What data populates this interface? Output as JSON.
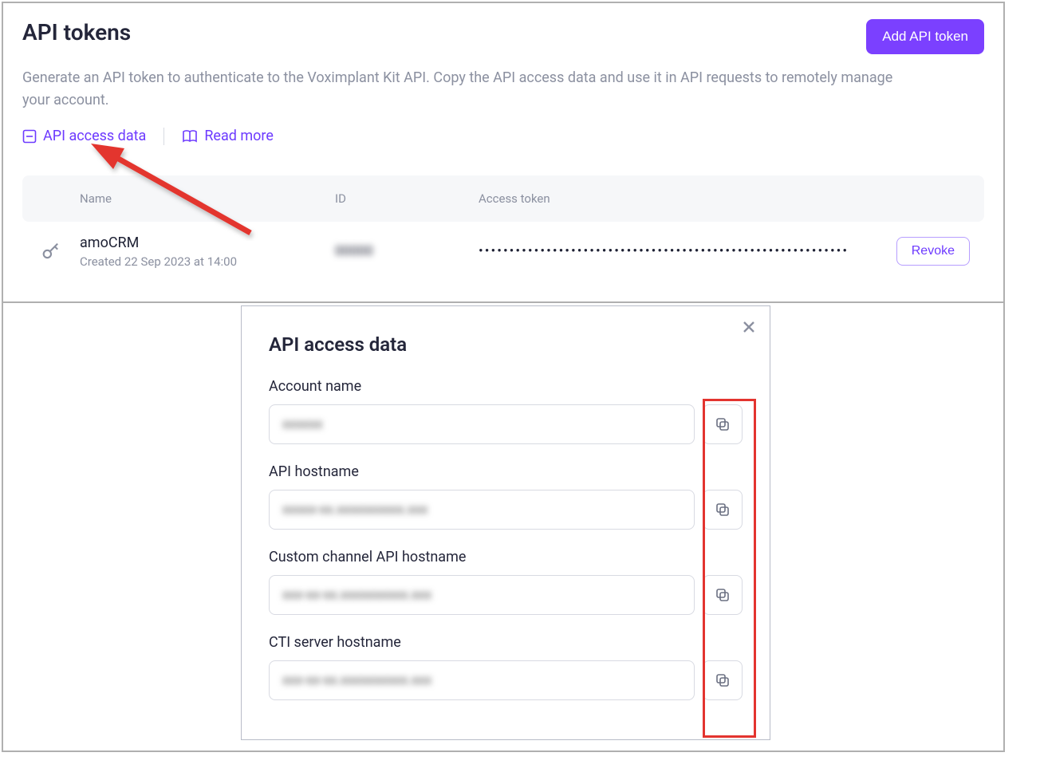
{
  "header": {
    "title": "API tokens",
    "add_button": "Add API token",
    "description": "Generate an API token to authenticate to the Voximplant Kit API. Copy the API access data and use it in API requests to remotely manage your account.",
    "links": {
      "access_data": "API access data",
      "read_more": "Read more"
    }
  },
  "table": {
    "columns": {
      "name": "Name",
      "id": "ID",
      "token": "Access token"
    },
    "rows": [
      {
        "name": "amoCRM",
        "created_prefix": "Created ",
        "created_at": "22 Sep 2023 at 14:00",
        "id": "00000",
        "token_mask": "••••••••••••••••••••••••••••••••••••••••••••••••••••••••••••",
        "revoke": "Revoke"
      }
    ]
  },
  "modal": {
    "title": "API access data",
    "fields": [
      {
        "label": "Account name",
        "value": "xxxxxx"
      },
      {
        "label": "API hostname",
        "value": "xxxxx-xx.xxxxxxxxxx.xxx"
      },
      {
        "label": "Custom channel API hostname",
        "value": "xxx-xx-xx.xxxxxxxxxx.xxx"
      },
      {
        "label": "CTI server hostname",
        "value": "xxx-xx-xx.xxxxxxxxxx.xxx"
      }
    ]
  }
}
